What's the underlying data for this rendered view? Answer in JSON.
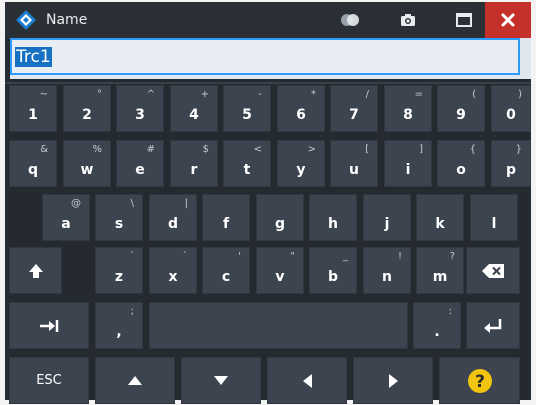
{
  "window": {
    "title": "Name"
  },
  "input": {
    "value": "Trc1"
  },
  "colors": {
    "accent": "#1671c2",
    "close": "#c4312d",
    "help": "#f1c40f",
    "key_bg": "#3c4450",
    "window_bg": "#252a31"
  },
  "keyboard": {
    "row1": [
      {
        "main": "1",
        "shift": "~"
      },
      {
        "main": "2",
        "shift": "°"
      },
      {
        "main": "3",
        "shift": "^"
      },
      {
        "main": "4",
        "shift": "+"
      },
      {
        "main": "5",
        "shift": "-"
      },
      {
        "main": "6",
        "shift": "*"
      },
      {
        "main": "7",
        "shift": "/"
      },
      {
        "main": "8",
        "shift": "="
      },
      {
        "main": "9",
        "shift": "("
      },
      {
        "main": "0",
        "shift": ")"
      }
    ],
    "row2": [
      {
        "main": "q",
        "shift": "&"
      },
      {
        "main": "w",
        "shift": "%"
      },
      {
        "main": "e",
        "shift": "#"
      },
      {
        "main": "r",
        "shift": "$"
      },
      {
        "main": "t",
        "shift": "<"
      },
      {
        "main": "y",
        "shift": ">"
      },
      {
        "main": "u",
        "shift": "["
      },
      {
        "main": "i",
        "shift": "]"
      },
      {
        "main": "o",
        "shift": "{"
      },
      {
        "main": "p",
        "shift": "}"
      }
    ],
    "row3": [
      {
        "main": "a",
        "shift": "@"
      },
      {
        "main": "s",
        "shift": "\\"
      },
      {
        "main": "d",
        "shift": "|"
      },
      {
        "main": "f",
        "shift": ""
      },
      {
        "main": "g",
        "shift": ""
      },
      {
        "main": "h",
        "shift": ""
      },
      {
        "main": "j",
        "shift": ""
      },
      {
        "main": "k",
        "shift": ""
      },
      {
        "main": "l",
        "shift": ""
      }
    ],
    "row4": [
      {
        "main": "z",
        "shift": "´"
      },
      {
        "main": "x",
        "shift": "`"
      },
      {
        "main": "c",
        "shift": "'"
      },
      {
        "main": "v",
        "shift": "\""
      },
      {
        "main": "b",
        "shift": "_"
      },
      {
        "main": "n",
        "shift": "!"
      },
      {
        "main": "m",
        "shift": "?"
      }
    ],
    "comma": {
      "main": ",",
      "shift": ";"
    },
    "period": {
      "main": ".",
      "shift": ":"
    },
    "esc_label": "ESC"
  }
}
